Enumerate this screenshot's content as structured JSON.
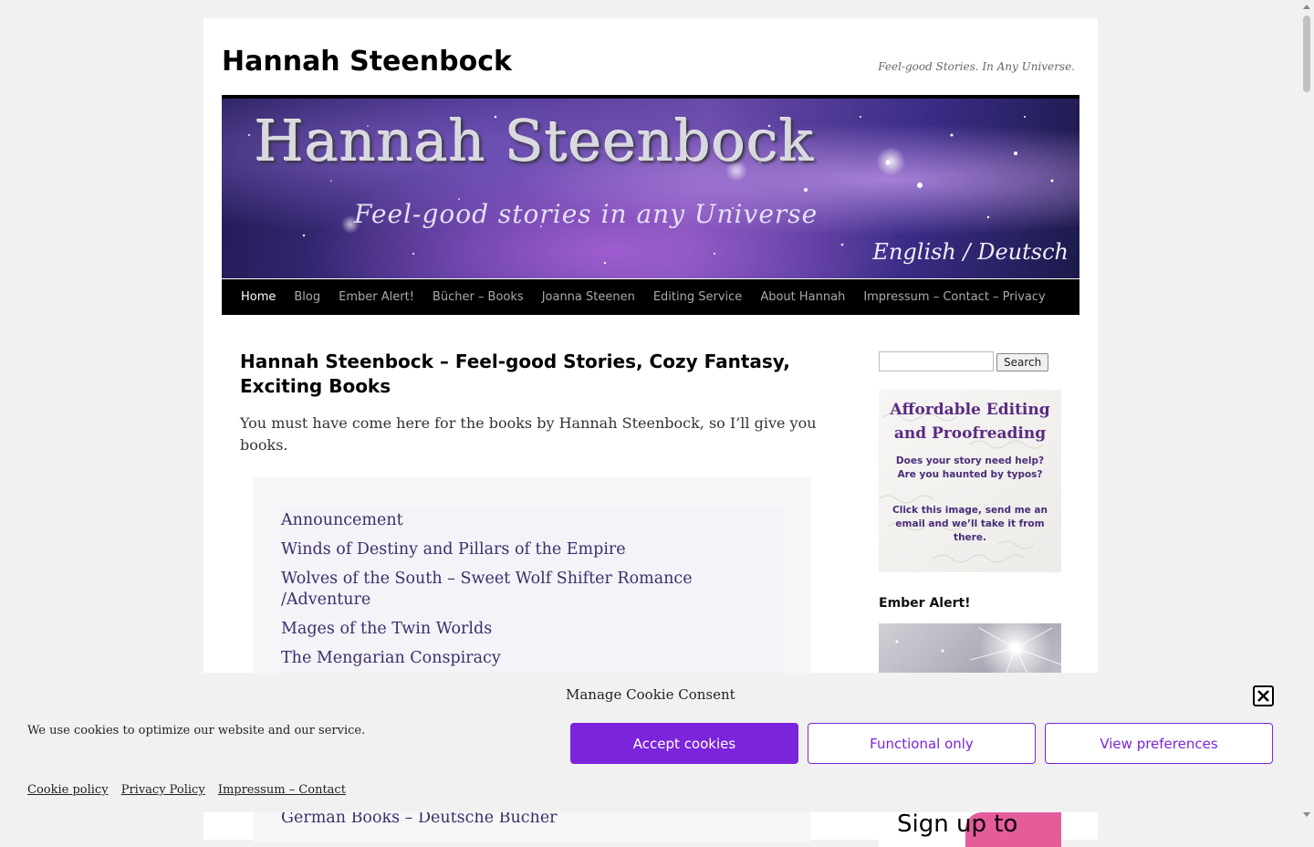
{
  "site": {
    "title": "Hannah Steenbock",
    "description": "Feel-good Stories. In Any Universe."
  },
  "banner": {
    "title": "Hannah Steenbock",
    "tagline": "Feel-good stories in any Universe",
    "language_link": "English / Deutsch"
  },
  "nav": {
    "items": [
      {
        "label": "Home",
        "active": true
      },
      {
        "label": "Blog"
      },
      {
        "label": "Ember Alert!"
      },
      {
        "label": "Bücher – Books"
      },
      {
        "label": "Joanna Steenen"
      },
      {
        "label": "Editing Service"
      },
      {
        "label": "About Hannah"
      },
      {
        "label": "Impressum – Contact – Privacy"
      }
    ]
  },
  "main": {
    "title": "Hannah Steenbock – Feel-good Stories, Cozy Fantasy, Exciting Books",
    "intro": "You must have come here for the books by Hannah Steenbock, so I’ll give you books.",
    "toc": [
      "Announcement",
      "Winds of Destiny and Pillars of the Empire",
      "Wolves of the South – Sweet Wolf Shifter Romance /Adventure",
      "Mages of the Twin Worlds",
      "The Mengarian Conspiracy"
    ],
    "toc_partial": "German Books – Deutsche Bücher"
  },
  "sidebar": {
    "search_button": "Search",
    "ad": {
      "title": "Affordable Editing and Proofreading",
      "line1": "Does your story need help?",
      "line2": "Are you haunted by typos?",
      "line3": "Click this image, send me an",
      "line4": "email and we’ll take it from there."
    },
    "ember_title": "Ember Alert!",
    "signup_text": "Sign up to"
  },
  "cookie": {
    "title": "Manage Cookie Consent",
    "message": "We use cookies to optimize our website and our service.",
    "accept": "Accept cookies",
    "functional": "Functional only",
    "preferences": "View preferences",
    "links": [
      "Cookie policy",
      "Privacy Policy",
      "Impressum – Contact"
    ],
    "accent_color": "#7b24db"
  }
}
